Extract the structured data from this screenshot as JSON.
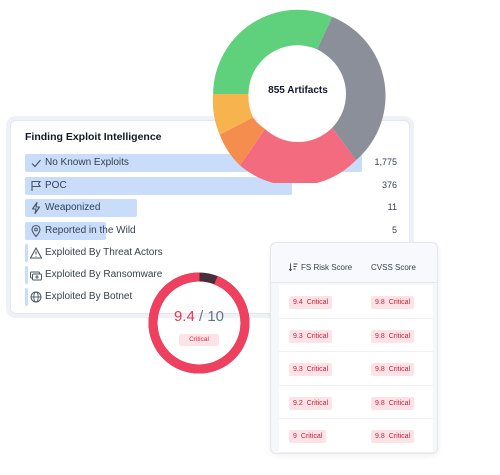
{
  "intel": {
    "title": "Finding Exploit Intelligence",
    "items": [
      {
        "label": "No Known Exploits",
        "value": "1,775",
        "count": 1775,
        "icon": "check-icon"
      },
      {
        "label": "POC",
        "value": "376",
        "count": 376,
        "icon": "flag-icon"
      },
      {
        "label": "Weaponized",
        "value": "11",
        "count": 11,
        "icon": "bolt-icon"
      },
      {
        "label": "Reported in the Wild",
        "value": "5",
        "count": 5,
        "icon": "location-pin-icon"
      },
      {
        "label": "Exploited By Threat Actors",
        "value": "",
        "count": 0,
        "icon": "warning-icon"
      },
      {
        "label": "Exploited By Ransomware",
        "value": "",
        "count": 0,
        "icon": "ransomware-icon"
      },
      {
        "label": "Exploited By Botnet",
        "value": "",
        "count": 0,
        "icon": "globe-icon"
      }
    ],
    "bar_color": "#c9ddfb"
  },
  "donut": {
    "center_label": "855 Artifacts",
    "segment_colors": [
      "#5fd07b",
      "#8a8f99",
      "#f26b7f",
      "#f58d4e",
      "#f7b34d"
    ]
  },
  "score_ring": {
    "score": "9.4",
    "max": "/ 10",
    "badge": "Critical",
    "fraction": 0.94,
    "color": "#f0405f",
    "remainder_color": "#4a2f3a"
  },
  "scores": {
    "fs_header": "FS Risk Score",
    "cvss_header": "CVSS Score",
    "rows": [
      {
        "fs_value": "9.4",
        "fs_label": "Critical",
        "cvss_value": "9.8",
        "cvss_label": "Critical"
      },
      {
        "fs_value": "9.3",
        "fs_label": "Critical",
        "cvss_value": "9.8",
        "cvss_label": "Critical"
      },
      {
        "fs_value": "9.3",
        "fs_label": "Critical",
        "cvss_value": "9.8",
        "cvss_label": "Critical"
      },
      {
        "fs_value": "9.2",
        "fs_label": "Critical",
        "cvss_value": "9.8",
        "cvss_label": "Critical"
      },
      {
        "fs_value": "9",
        "fs_label": "Critical",
        "cvss_value": "9.8",
        "cvss_label": "Critical"
      }
    ]
  }
}
